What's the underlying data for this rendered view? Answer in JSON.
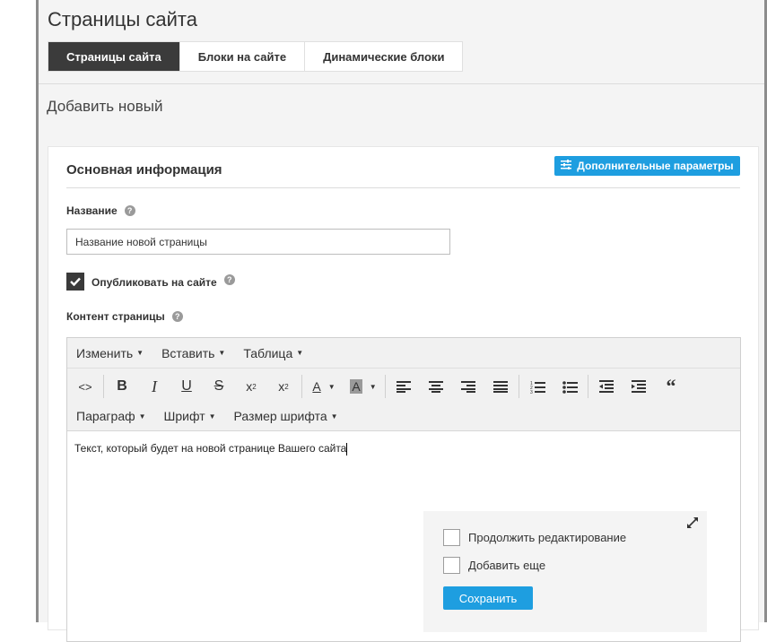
{
  "page": {
    "title": "Страницы сайта",
    "tabs": [
      {
        "label": "Страницы сайта",
        "active": true
      },
      {
        "label": "Блоки на сайте",
        "active": false
      },
      {
        "label": "Динамические блоки",
        "active": false
      }
    ],
    "subtitle": "Добавить новый"
  },
  "card": {
    "title": "Основная информация",
    "advanced_button": "Дополнительные параметры",
    "name_label": "Название",
    "name_value": "Название новой страницы",
    "publish_label": "Опубликовать на сайте",
    "publish_checked": true,
    "content_label": "Контент страницы"
  },
  "editor": {
    "menus": [
      "Изменить",
      "Вставить",
      "Таблица"
    ],
    "format_menus": [
      "Параграф",
      "Шрифт",
      "Размер шрифта"
    ],
    "toolbar_icons": [
      "code-icon",
      "bold-icon",
      "italic-icon",
      "underline-icon",
      "strikethrough-icon",
      "superscript-icon",
      "subscript-icon",
      "text-color-icon",
      "background-color-icon",
      "align-left-icon",
      "align-center-icon",
      "align-right-icon",
      "align-justify-icon",
      "numbered-list-icon",
      "bullet-list-icon",
      "outdent-icon",
      "indent-icon",
      "blockquote-icon"
    ],
    "content": "Текст, который будет на новой странице Вашего сайта"
  },
  "save_panel": {
    "continue_label": "Продолжить редактирование",
    "add_more_label": "Добавить еще",
    "save_button": "Сохранить"
  },
  "colors": {
    "accent": "#1e9ee0",
    "active_tab": "#3b3b3b"
  }
}
